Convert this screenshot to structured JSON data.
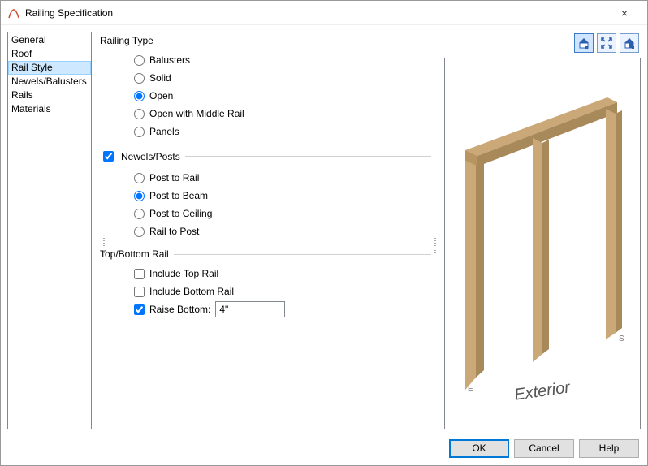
{
  "window": {
    "title": "Railing Specification",
    "close_label": "×"
  },
  "sidebar": {
    "items": [
      {
        "label": "General"
      },
      {
        "label": "Roof"
      },
      {
        "label": "Rail Style",
        "selected": true
      },
      {
        "label": "Newels/Balusters"
      },
      {
        "label": "Rails"
      },
      {
        "label": "Materials"
      }
    ]
  },
  "groups": {
    "railing_type": {
      "title": "Railing Type",
      "options": [
        {
          "label": "Balusters",
          "checked": false
        },
        {
          "label": "Solid",
          "checked": false
        },
        {
          "label": "Open",
          "checked": true
        },
        {
          "label": "Open with Middle Rail",
          "checked": false
        },
        {
          "label": "Panels",
          "checked": false
        }
      ]
    },
    "newels_posts": {
      "title": "Newels/Posts",
      "enabled": true,
      "options": [
        {
          "label": "Post to Rail",
          "checked": false
        },
        {
          "label": "Post to Beam",
          "checked": true
        },
        {
          "label": "Post to Ceiling",
          "checked": false
        },
        {
          "label": "Rail to Post",
          "checked": false
        }
      ]
    },
    "top_bottom_rail": {
      "title": "Top/Bottom Rail",
      "include_top": {
        "label": "Include Top Rail",
        "checked": false
      },
      "include_bottom": {
        "label": "Include Bottom Rail",
        "checked": false
      },
      "raise_bottom": {
        "label": "Raise Bottom:",
        "checked": true,
        "value": "4\""
      }
    }
  },
  "toolbar": {
    "color_toggle_name": "color-toggle-icon",
    "zoom_extents_name": "zoom-extents-icon",
    "final_view_name": "final-view-icon"
  },
  "preview": {
    "label_e": "E",
    "label_s": "S",
    "caption": "Exterior"
  },
  "buttons": {
    "ok": "OK",
    "cancel": "Cancel",
    "help": "Help"
  }
}
